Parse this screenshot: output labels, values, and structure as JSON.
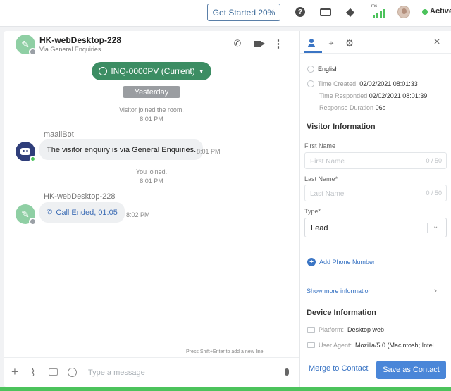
{
  "topbar": {
    "get_started_label": "Get Started 20%",
    "help_icon": "help-circle-icon",
    "keyboard_icon": "keyboard-icon",
    "tag_icon": "tag-icon",
    "signal_label": "mc",
    "status_label": "Active",
    "status_color": "#4cc35c"
  },
  "chat": {
    "header": {
      "name": "HK-webDesktop-228",
      "subtitle": "Via General Enquiries"
    },
    "inquiry_label": "INQ-0000PV (Current)",
    "date_divider": "Yesterday",
    "messages": [
      {
        "type": "system",
        "text": "Visitor joined the room.",
        "time": "8:01 PM"
      },
      {
        "type": "bot",
        "sender": "maaiiBot",
        "text": "The visitor enquiry is via General Enquiries.",
        "time": "8:01 PM"
      },
      {
        "type": "system",
        "text": "You joined.",
        "time": "8:01 PM"
      },
      {
        "type": "call",
        "sender": "HK-webDesktop-228",
        "text": "Call Ended, 01:05",
        "time": "8:02 PM"
      }
    ],
    "composer": {
      "placeholder": "Type a message",
      "hint": "Press Shift+Enter to add a new line"
    }
  },
  "info_panel": {
    "language": "English",
    "time_created_label": "Time Created",
    "time_created": "02/02/2021 08:01:33",
    "time_responded_label": "Time Responded",
    "time_responded": "02/02/2021 08:01:39",
    "response_duration_label": "Response Duration",
    "response_duration": "06s",
    "visitor_info_title": "Visitor Information",
    "first_name_label": "First Name",
    "first_name_placeholder": "First Name",
    "first_name_counter": "0 / 50",
    "last_name_label": "Last Name*",
    "last_name_placeholder": "Last Name",
    "last_name_counter": "0 / 50",
    "type_label": "Type*",
    "type_value": "Lead",
    "add_phone_label": "Add Phone Number",
    "show_more_label": "Show more information",
    "device_info_title": "Device Information",
    "platform_label": "Platform:",
    "platform_value": "Desktop web",
    "user_agent_label": "User Agent:",
    "user_agent_value": "Mozilla/5.0 (Macintosh; Intel",
    "merge_label": "Merge to Contact",
    "save_label": "Save as Contact"
  },
  "colors": {
    "accent_blue": "#4a86d8",
    "inquiry_green": "#3c8d63",
    "bot_navy": "#2f3e7a"
  }
}
